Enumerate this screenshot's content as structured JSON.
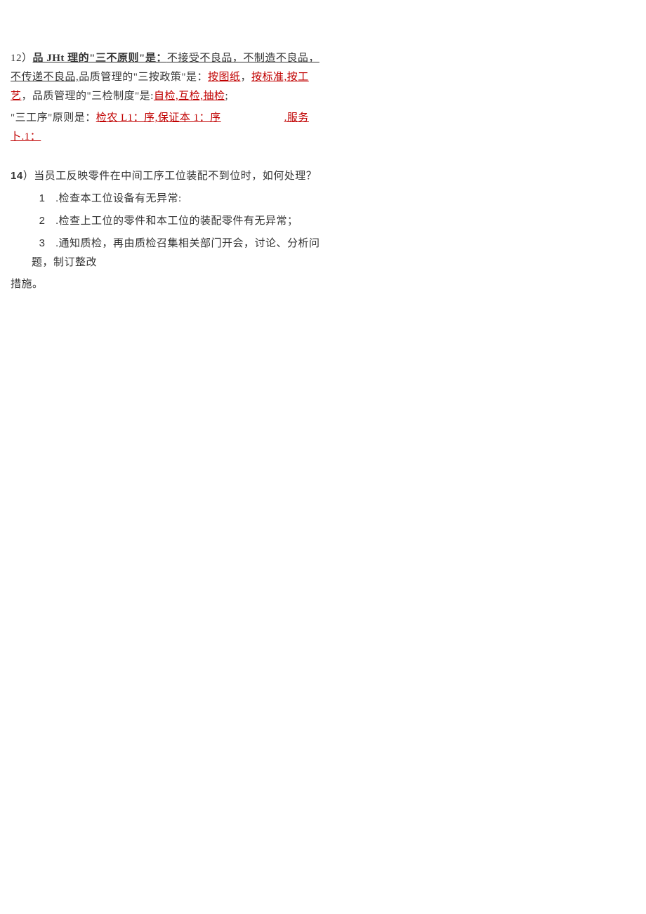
{
  "q12": {
    "prefix": "12）",
    "title_bold": "品 JHt 理的\"三不原则\"是：",
    "title_rest": "不接受不良品，不制造不良品，不传递不良品,",
    "after1": "品质管理的\"三按政策\"是：",
    "link1": "按图纸",
    "comma1": "，",
    "link2": "按标准,按工艺",
    "after2": "，品质管理的\"三检制度\"是:",
    "link3": "自检,互检,抽检",
    "semi": ";",
    "line3a": "\"三工序\"原则是：",
    "link4": "检农 L1：序,保证本 1：序",
    "dot": ".",
    "link5": "服务卜.1："
  },
  "q14": {
    "num": "14",
    "title": "）当员工反映零件在中间工序工位装配不到位时，如何处理？",
    "item1_num": "1",
    "item1": " .检查本工位设备有无异常:",
    "item2_num": "2",
    "item2": " .检查上工位的零件和本工位的装配零件有无异常；",
    "item3_num": "3",
    "item3": " .通知质检，再由质检召集相关部门开会，讨论、分析问题，制订整改",
    "item3_cont": "措施。"
  }
}
